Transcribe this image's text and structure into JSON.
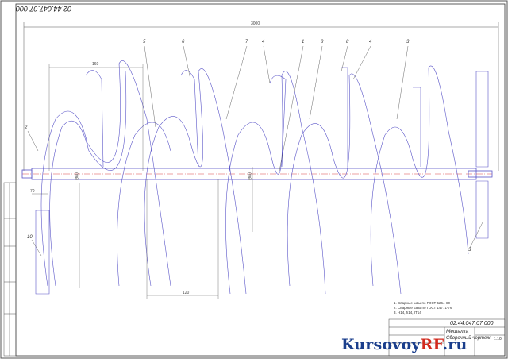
{
  "drawing": {
    "rotated_code": "02.44.047.07.000",
    "notes": [
      "1. Сварные швы по ГОСТ 5264-80",
      "2. Сварные швы по ГОСТ 14771-76",
      "3. Н14, h14, IT14"
    ],
    "title_block": {
      "designation": "02.44.047.07.000",
      "name_line1": "Мешалка",
      "name_line2": "Сборочный чертеж",
      "scale": "1:10"
    },
    "dimensions": {
      "overall_length": "3000",
      "left_pitch": "160",
      "bottom_pitch": "120",
      "shaft_dia_left": "Ø60",
      "shaft_dia_mid": "Ø60",
      "end_len": "70"
    },
    "leaders": [
      "5",
      "6",
      "7",
      "4",
      "1",
      "8",
      "8",
      "4",
      "3",
      "2",
      "10",
      "3"
    ]
  },
  "watermark": {
    "brand": "Kursovoy",
    "accent": "RF",
    "suffix": ".ru"
  },
  "colors": {
    "lines": "#5a55c8",
    "frame": "#444444",
    "watermark_blue": "#1a3e8c",
    "watermark_red": "#d22a1e"
  }
}
